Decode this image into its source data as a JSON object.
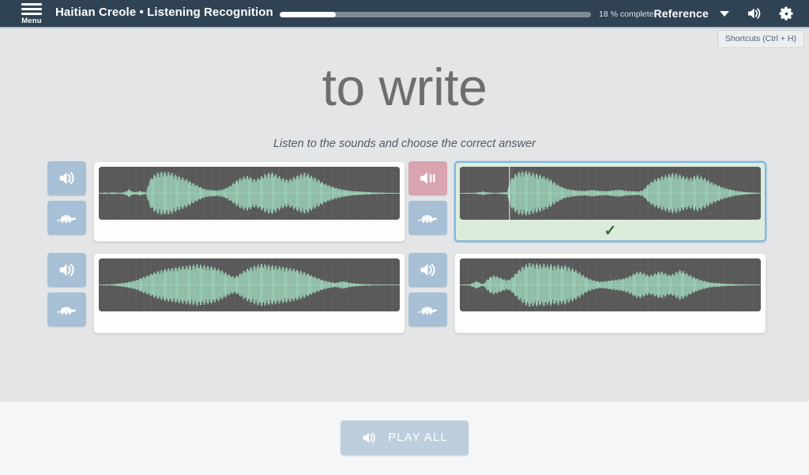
{
  "header": {
    "menu_label": "Menu",
    "menu_icon": "hamburger-menu-icon",
    "title": "Haitian Creole • Listening Recognition",
    "progress_percent": 18,
    "progress_label": "18 % complete",
    "mode_label": "Reference",
    "caret_icon": "chevron-down-icon",
    "volume_icon": "speaker-icon",
    "settings_icon": "gear-icon"
  },
  "tooltip": {
    "shortcuts_label": "Shortcuts (Ctrl + H)"
  },
  "main": {
    "prompt": "to write",
    "instruction": "Listen to the sounds and choose the correct answer",
    "checkmark": "✓"
  },
  "options": [
    {
      "id": "option-1",
      "play_icon": "speaker-icon",
      "slow_icon": "turtle-icon",
      "state": "idle",
      "selected": false,
      "checked": false,
      "playhead": null
    },
    {
      "id": "option-2",
      "play_icon": "speaker-pause-icon",
      "slow_icon": "turtle-icon",
      "state": "playing",
      "selected": true,
      "checked": true,
      "playhead": 0.165
    },
    {
      "id": "option-3",
      "play_icon": "speaker-icon",
      "slow_icon": "turtle-icon",
      "state": "idle",
      "selected": false,
      "checked": false,
      "playhead": null
    },
    {
      "id": "option-4",
      "play_icon": "speaker-icon",
      "slow_icon": "turtle-icon",
      "state": "idle",
      "selected": false,
      "checked": false,
      "playhead": null
    }
  ],
  "footer": {
    "play_all_label": "PLAY ALL",
    "play_all_icon": "speaker-icon"
  },
  "colors": {
    "header_bg": "#2f4355",
    "main_bg": "#e3e5e7",
    "footer_bg": "#f5f6f7",
    "wave_bg": "#595959",
    "wave_stroke": "#a8e6c8",
    "button_blue": "#a7c0d6",
    "button_playing": "#d9a3b0",
    "selected_bg": "#dcecdc",
    "selected_border": "#7fb8e0",
    "check_color": "#2f6b2f",
    "prompt_color": "#6e6e6e"
  },
  "waveforms": {
    "option-1": [
      0.02,
      0.02,
      0.03,
      0.02,
      0.04,
      0.03,
      0.02,
      0.03,
      0.08,
      0.16,
      0.07,
      0.05,
      0.1,
      0.06,
      0.04,
      0.55,
      0.72,
      0.84,
      0.88,
      0.92,
      0.86,
      0.9,
      0.82,
      0.76,
      0.7,
      0.64,
      0.58,
      0.5,
      0.42,
      0.34,
      0.26,
      0.2,
      0.16,
      0.14,
      0.13,
      0.12,
      0.14,
      0.18,
      0.24,
      0.34,
      0.46,
      0.56,
      0.64,
      0.7,
      0.72,
      0.66,
      0.58,
      0.62,
      0.7,
      0.78,
      0.84,
      0.88,
      0.82,
      0.74,
      0.66,
      0.6,
      0.56,
      0.62,
      0.7,
      0.76,
      0.82,
      0.86,
      0.8,
      0.72,
      0.64,
      0.56,
      0.48,
      0.4,
      0.34,
      0.28,
      0.24,
      0.2,
      0.17,
      0.14,
      0.12,
      0.1,
      0.09,
      0.08,
      0.07,
      0.06,
      0.05,
      0.04,
      0.04,
      0.03,
      0.03,
      0.02,
      0.02,
      0.02,
      0.01,
      0.01
    ],
    "option-2": [
      0.01,
      0.01,
      0.02,
      0.02,
      0.02,
      0.03,
      0.05,
      0.08,
      0.04,
      0.03,
      0.02,
      0.02,
      0.03,
      0.04,
      0.06,
      0.58,
      0.74,
      0.86,
      0.92,
      0.9,
      0.94,
      0.88,
      0.84,
      0.8,
      0.76,
      0.7,
      0.64,
      0.56,
      0.46,
      0.36,
      0.28,
      0.22,
      0.18,
      0.15,
      0.13,
      0.12,
      0.11,
      0.1,
      0.12,
      0.14,
      0.13,
      0.11,
      0.1,
      0.09,
      0.1,
      0.12,
      0.14,
      0.16,
      0.13,
      0.11,
      0.1,
      0.09,
      0.08,
      0.08,
      0.12,
      0.26,
      0.42,
      0.52,
      0.6,
      0.66,
      0.72,
      0.76,
      0.8,
      0.84,
      0.82,
      0.78,
      0.72,
      0.68,
      0.64,
      0.7,
      0.76,
      0.72,
      0.66,
      0.58,
      0.5,
      0.42,
      0.36,
      0.3,
      0.24,
      0.2,
      0.16,
      0.13,
      0.1,
      0.08,
      0.06,
      0.05,
      0.04,
      0.03,
      0.02,
      0.02
    ],
    "option-3": [
      0.01,
      0.01,
      0.02,
      0.02,
      0.03,
      0.04,
      0.06,
      0.08,
      0.1,
      0.13,
      0.16,
      0.2,
      0.26,
      0.32,
      0.38,
      0.44,
      0.5,
      0.56,
      0.6,
      0.64,
      0.68,
      0.7,
      0.72,
      0.74,
      0.76,
      0.78,
      0.8,
      0.82,
      0.84,
      0.86,
      0.84,
      0.82,
      0.8,
      0.78,
      0.74,
      0.7,
      0.64,
      0.56,
      0.48,
      0.4,
      0.34,
      0.4,
      0.5,
      0.6,
      0.68,
      0.74,
      0.8,
      0.84,
      0.88,
      0.86,
      0.84,
      0.82,
      0.8,
      0.78,
      0.76,
      0.74,
      0.72,
      0.7,
      0.66,
      0.62,
      0.58,
      0.52,
      0.46,
      0.4,
      0.34,
      0.28,
      0.22,
      0.18,
      0.14,
      0.11,
      0.09,
      0.12,
      0.16,
      0.14,
      0.1,
      0.08,
      0.06,
      0.05,
      0.04,
      0.03,
      0.03,
      0.02,
      0.02,
      0.02,
      0.01,
      0.01,
      0.01,
      0.01,
      0.01,
      0.01
    ],
    "option-4": [
      0.01,
      0.02,
      0.02,
      0.03,
      0.1,
      0.16,
      0.08,
      0.04,
      0.22,
      0.34,
      0.4,
      0.36,
      0.3,
      0.24,
      0.2,
      0.26,
      0.4,
      0.56,
      0.7,
      0.8,
      0.88,
      0.92,
      0.86,
      0.9,
      0.84,
      0.88,
      0.82,
      0.86,
      0.8,
      0.84,
      0.78,
      0.82,
      0.76,
      0.7,
      0.64,
      0.56,
      0.46,
      0.36,
      0.28,
      0.22,
      0.18,
      0.15,
      0.14,
      0.16,
      0.18,
      0.2,
      0.22,
      0.24,
      0.26,
      0.3,
      0.36,
      0.44,
      0.52,
      0.56,
      0.52,
      0.46,
      0.4,
      0.44,
      0.5,
      0.56,
      0.54,
      0.48,
      0.42,
      0.46,
      0.54,
      0.62,
      0.58,
      0.5,
      0.42,
      0.34,
      0.28,
      0.22,
      0.18,
      0.14,
      0.11,
      0.09,
      0.08,
      0.07,
      0.06,
      0.05,
      0.04,
      0.04,
      0.03,
      0.03,
      0.02,
      0.02,
      0.02,
      0.01,
      0.01,
      0.01
    ]
  }
}
